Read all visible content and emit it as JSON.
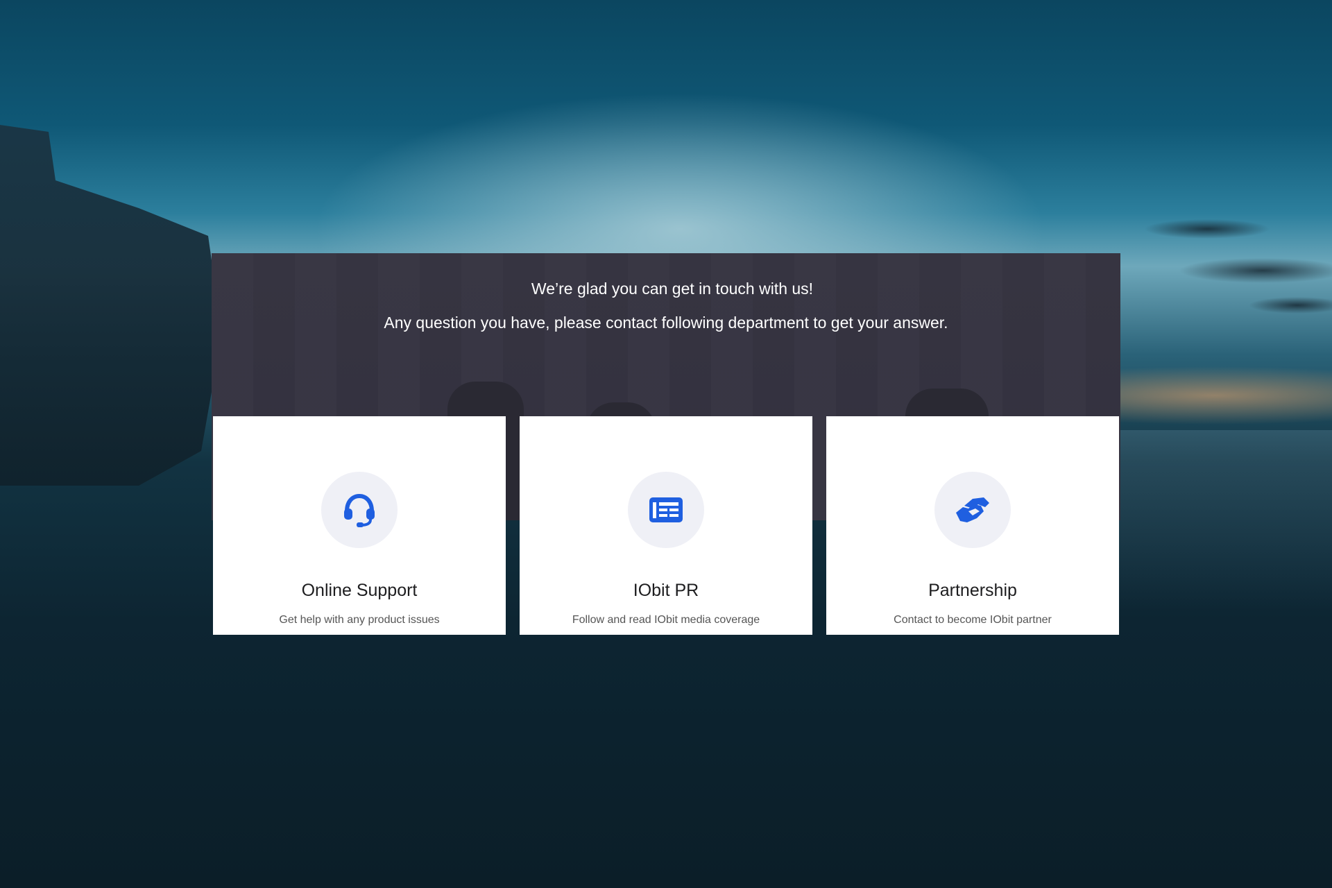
{
  "hero": {
    "line1": "We’re glad you can get in touch with us!",
    "line2": "Any question you have, please contact following department to get your answer."
  },
  "cards": [
    {
      "title": "Online Support",
      "description": "Get help with any product issues",
      "icon": "headset-icon"
    },
    {
      "title": "IObit PR",
      "description": "Follow and read IObit media coverage",
      "icon": "newspaper-icon"
    },
    {
      "title": "Partnership",
      "description": "Contact to become IObit partner",
      "icon": "handshake-icon"
    }
  ],
  "colors": {
    "accent": "#1f5fe0",
    "icon_bg": "#eff0f6",
    "hero_bg": "#363442"
  }
}
